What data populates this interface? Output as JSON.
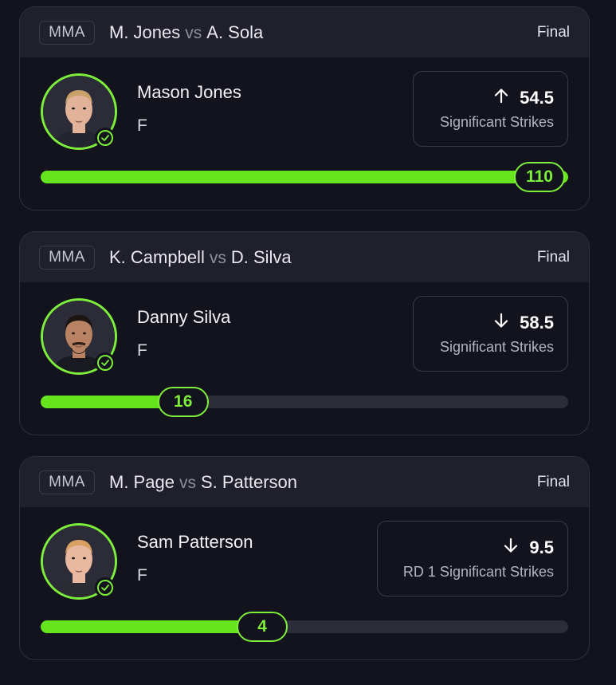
{
  "colors": {
    "background": "#13131d",
    "header": "#1f202b",
    "accent": "#7dee3c",
    "bar": "#66e41e",
    "track": "#2c2d38"
  },
  "cards": [
    {
      "sport": "MMA",
      "fighter_a": "M. Jones",
      "vs": "vs",
      "fighter_b": "A. Sola",
      "status": "Final",
      "player_name": "Mason Jones",
      "position": "F",
      "direction": "up",
      "direction_icon": "arrow-up-icon",
      "line": "54.5",
      "stat_label": "Significant Strikes",
      "result": "110",
      "progress": 1.0,
      "avatar": {
        "skin": "#e2b39a",
        "hair": "#c9a26a",
        "shirt": "#24252f",
        "beard": "none"
      }
    },
    {
      "sport": "MMA",
      "fighter_a": "K. Campbell",
      "vs": "vs",
      "fighter_b": "D. Silva",
      "status": "Final",
      "player_name": "Danny Silva",
      "position": "F",
      "direction": "down",
      "direction_icon": "arrow-down-icon",
      "line": "58.5",
      "stat_label": "Significant Strikes",
      "result": "16",
      "progress": 0.27,
      "avatar": {
        "skin": "#b98262",
        "hair": "#1c1512",
        "shirt": "#1a1b22",
        "beard": "#2a1d17"
      }
    },
    {
      "sport": "MMA",
      "fighter_a": "M. Page",
      "vs": "vs",
      "fighter_b": "S. Patterson",
      "status": "Final",
      "player_name": "Sam Patterson",
      "position": "F",
      "direction": "down",
      "direction_icon": "arrow-down-icon",
      "line": "9.5",
      "stat_label": "RD 1 Significant Strikes",
      "result": "4",
      "progress": 0.42,
      "avatar": {
        "skin": "#e8b8a0",
        "hair": "#d9a063",
        "shirt": "#2a2b33",
        "beard": "none"
      }
    }
  ]
}
